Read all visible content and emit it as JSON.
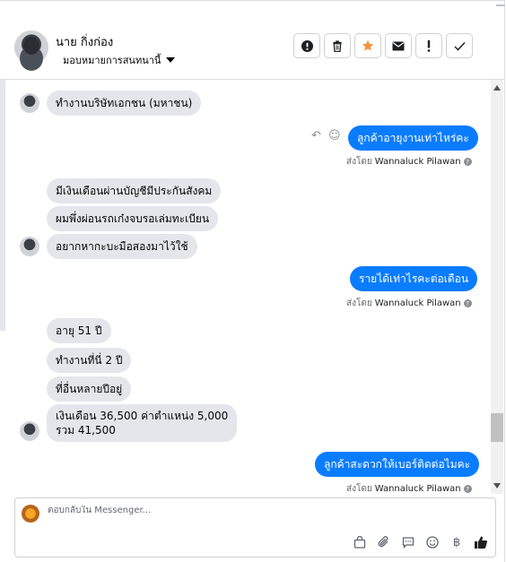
{
  "header": {
    "contact_name": "นาย กิ่งก่อง",
    "assign_label": "มอบหมายการสนทนานี้",
    "actions": [
      {
        "name": "spam-button",
        "glyph": "!",
        "icon": "exclamation-circle-icon"
      },
      {
        "name": "delete-button",
        "glyph": "🗑",
        "icon": "trash-icon"
      },
      {
        "name": "star-button",
        "glyph": "★",
        "icon": "star-icon"
      },
      {
        "name": "mark-unread-button",
        "glyph": "✉",
        "icon": "envelope-icon"
      },
      {
        "name": "follow-up-button",
        "glyph": "!",
        "icon": "exclamation-icon"
      },
      {
        "name": "done-button",
        "glyph": "✓",
        "icon": "check-icon"
      }
    ]
  },
  "messages": [
    {
      "dir": "in",
      "text": "ทำงานบริษัทเอกชน (มหาชน)"
    },
    {
      "dir": "out",
      "text": "ลูกค้าอายุงานเท่าไหร่คะ",
      "sent_by": "ส่งโดย",
      "agent": "Wannaluck Pilawan"
    },
    {
      "dir": "in",
      "text": "มีเงินเดือนผ่านบัญชีมีประกันสังคม"
    },
    {
      "dir": "in",
      "text": "ผมพึ่งผ่อนรถเก๋งจบรอเล่มทะเบียน"
    },
    {
      "dir": "in",
      "text": "อยากหากะบะมือสองมาไว้ใช้"
    },
    {
      "dir": "out",
      "text": "รายได้เท่าไรคะต่อเดือน",
      "sent_by": "ส่งโดย",
      "agent": "Wannaluck Pilawan"
    },
    {
      "dir": "in",
      "text": "อายุ 51 ปี"
    },
    {
      "dir": "in",
      "text": "ทำงานที่นี่ 2 ปี"
    },
    {
      "dir": "in",
      "text": "ที่อื่นหลายปีอยู่"
    },
    {
      "dir": "in",
      "text": "เงินเดือน 36,500 ค่าตำแหน่ง 5,000"
    },
    {
      "dir": "in",
      "text": "รวม 41,500"
    },
    {
      "dir": "out",
      "text": "ลูกค้าสะดวกให้เบอร์ติดต่อไมคะ",
      "sent_by": "ส่งโดย",
      "agent": "Wannaluck Pilawan"
    }
  ],
  "composer": {
    "placeholder": "ตอบกลับใน Messenger...",
    "tools": [
      "bag-icon",
      "paperclip-icon",
      "speech-bubble-icon",
      "smiley-icon",
      "baht-icon",
      "thumbs-up-icon"
    ]
  }
}
